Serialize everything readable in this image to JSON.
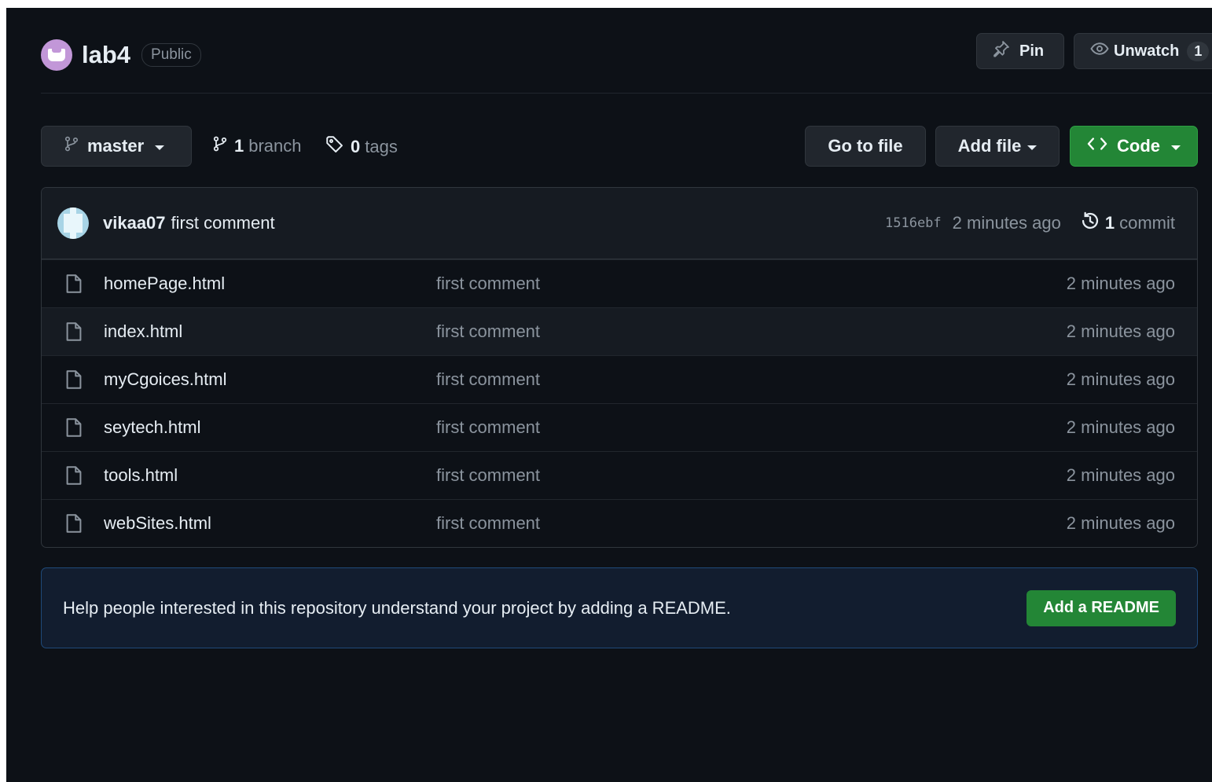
{
  "repo": {
    "name": "lab4",
    "visibility": "Public",
    "avatar_icon": "owner-avatar",
    "pin_label": "Pin",
    "watch_label": "Unwatch",
    "watch_count": "1"
  },
  "toolbar": {
    "branch": "master",
    "branch_count": "1",
    "branch_word": "branch",
    "tag_count": "0",
    "tag_word": "tags",
    "goto_file": "Go to file",
    "add_file": "Add file",
    "code": "Code"
  },
  "latest_commit": {
    "author": "vikaa07",
    "message": "first comment",
    "sha": "1516ebf",
    "time": "2 minutes ago",
    "commit_count": "1",
    "commit_word": "commit"
  },
  "files": [
    {
      "name": "homePage.html",
      "message": "first comment",
      "time": "2 minutes ago"
    },
    {
      "name": "index.html",
      "message": "first comment",
      "time": "2 minutes ago"
    },
    {
      "name": "myCgoices.html",
      "message": "first comment",
      "time": "2 minutes ago"
    },
    {
      "name": "seytech.html",
      "message": "first comment",
      "time": "2 minutes ago"
    },
    {
      "name": "tools.html",
      "message": "first comment",
      "time": "2 minutes ago"
    },
    {
      "name": "webSites.html",
      "message": "first comment",
      "time": "2 minutes ago"
    }
  ],
  "readme_banner": {
    "text": "Help people interested in this repository understand your project by adding a README.",
    "button": "Add a README"
  },
  "colors": {
    "background": "#0d1117",
    "primary_button": "#238636",
    "border": "#30363d",
    "muted_text": "#8b949e"
  }
}
